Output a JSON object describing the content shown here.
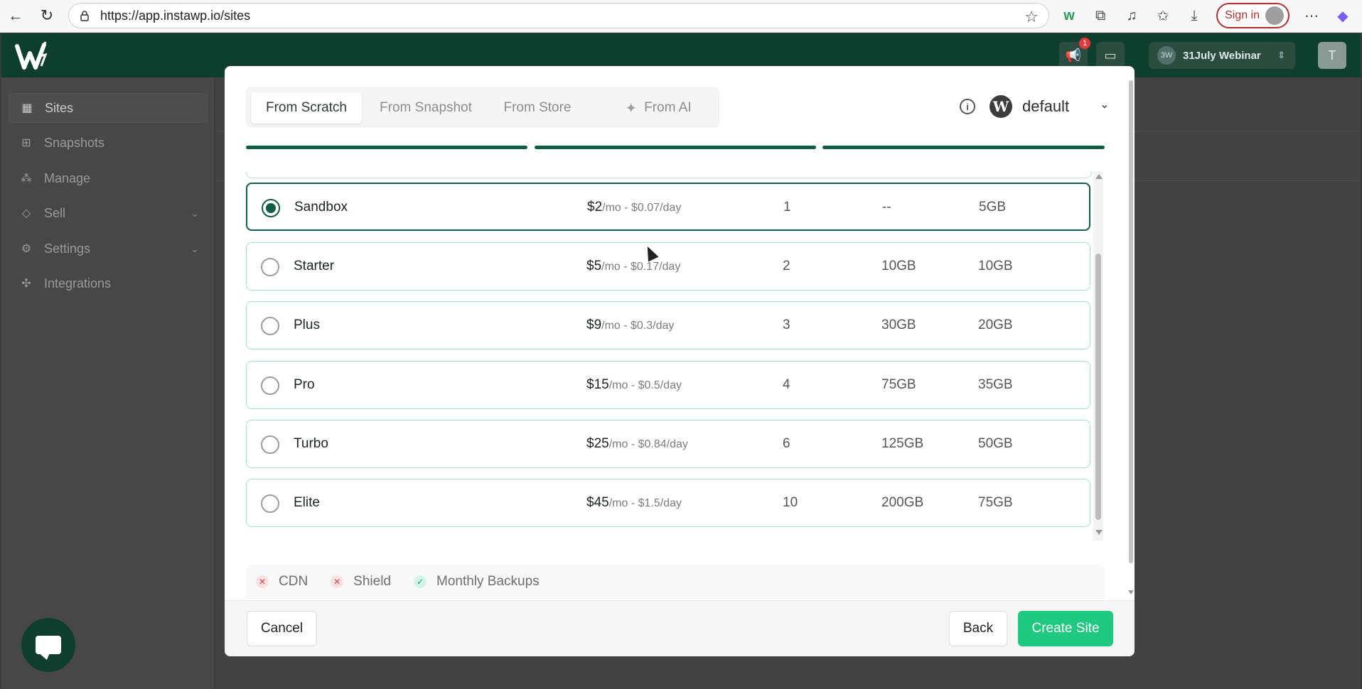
{
  "browser": {
    "url": "https://app.instawp.io/sites",
    "signin_label": "Sign in"
  },
  "header": {
    "notif_count": "1",
    "team_initials": "3W",
    "team_name": "31July Webinar",
    "user_initial": "T"
  },
  "sidebar": {
    "items": [
      {
        "label": "Sites",
        "icon": "layout-icon",
        "active": true
      },
      {
        "label": "Snapshots",
        "icon": "grid-icon"
      },
      {
        "label": "Manage",
        "icon": "nodes-icon"
      },
      {
        "label": "Sell",
        "icon": "tag-icon",
        "chevron": true
      },
      {
        "label": "Settings",
        "icon": "gear-icon",
        "chevron": true
      },
      {
        "label": "Integrations",
        "icon": "puzzle-icon"
      }
    ]
  },
  "modal": {
    "tabs": [
      {
        "label": "From Scratch",
        "active": true
      },
      {
        "label": "From Snapshot"
      },
      {
        "label": "From Store"
      },
      {
        "label": "From AI"
      }
    ],
    "profile": "default",
    "plans": [
      {
        "name": "Sandbox",
        "price": "$2",
        "per": "/mo - $0.07/day",
        "sites": "1",
        "bandwidth": "--",
        "storage": "5GB",
        "selected": true
      },
      {
        "name": "Starter",
        "price": "$5",
        "per": "/mo - $0.17/day",
        "sites": "2",
        "bandwidth": "10GB",
        "storage": "10GB"
      },
      {
        "name": "Plus",
        "price": "$9",
        "per": "/mo - $0.3/day",
        "sites": "3",
        "bandwidth": "30GB",
        "storage": "20GB"
      },
      {
        "name": "Pro",
        "price": "$15",
        "per": "/mo - $0.5/day",
        "sites": "4",
        "bandwidth": "75GB",
        "storage": "35GB"
      },
      {
        "name": "Turbo",
        "price": "$25",
        "per": "/mo - $0.84/day",
        "sites": "6",
        "bandwidth": "125GB",
        "storage": "50GB"
      },
      {
        "name": "Elite",
        "price": "$45",
        "per": "/mo - $1.5/day",
        "sites": "10",
        "bandwidth": "200GB",
        "storage": "75GB"
      }
    ],
    "features": [
      {
        "label": "CDN",
        "enabled": false
      },
      {
        "label": "Shield",
        "enabled": false
      },
      {
        "label": "Monthly Backups",
        "enabled": true
      }
    ],
    "buttons": {
      "cancel": "Cancel",
      "back": "Back",
      "create": "Create Site"
    }
  },
  "colors": {
    "brand_dark": "#0e3e2e",
    "accent": "#1fc980",
    "selected_border": "#135c45"
  }
}
